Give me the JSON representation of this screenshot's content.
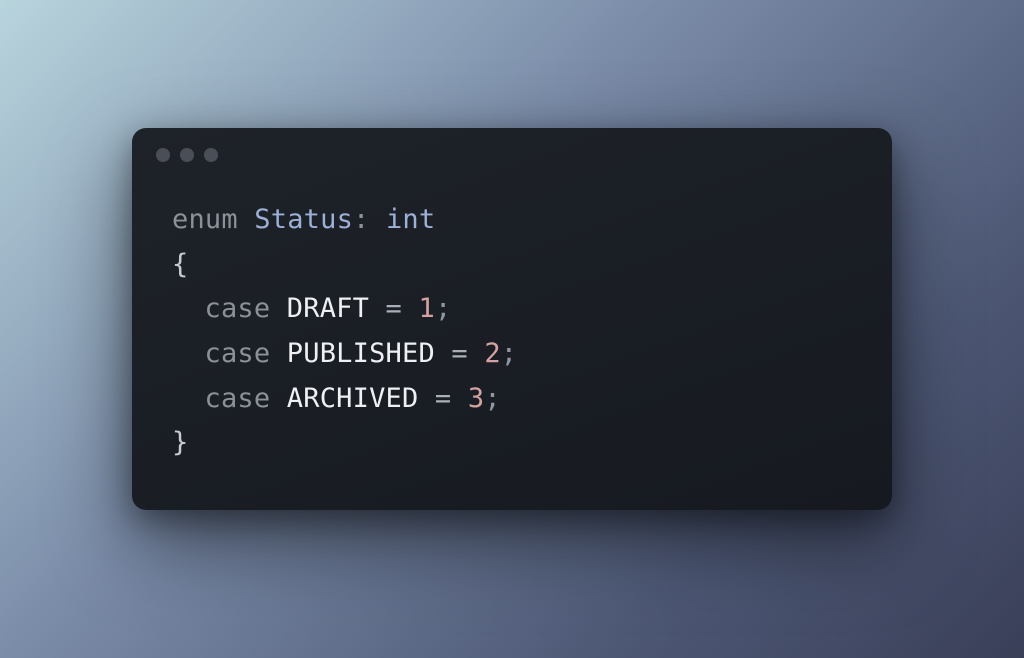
{
  "code": {
    "enum_keyword": "enum",
    "enum_name": "Status",
    "colon": ":",
    "backing_type": "int",
    "open_brace": "{",
    "close_brace": "}",
    "cases": [
      {
        "keyword": "case",
        "name": "DRAFT",
        "equals": "=",
        "value": "1",
        "semi": ";"
      },
      {
        "keyword": "case",
        "name": "PUBLISHED",
        "equals": "=",
        "value": "2",
        "semi": ";"
      },
      {
        "keyword": "case",
        "name": "ARCHIVED",
        "equals": "=",
        "value": "3",
        "semi": ";"
      }
    ]
  }
}
